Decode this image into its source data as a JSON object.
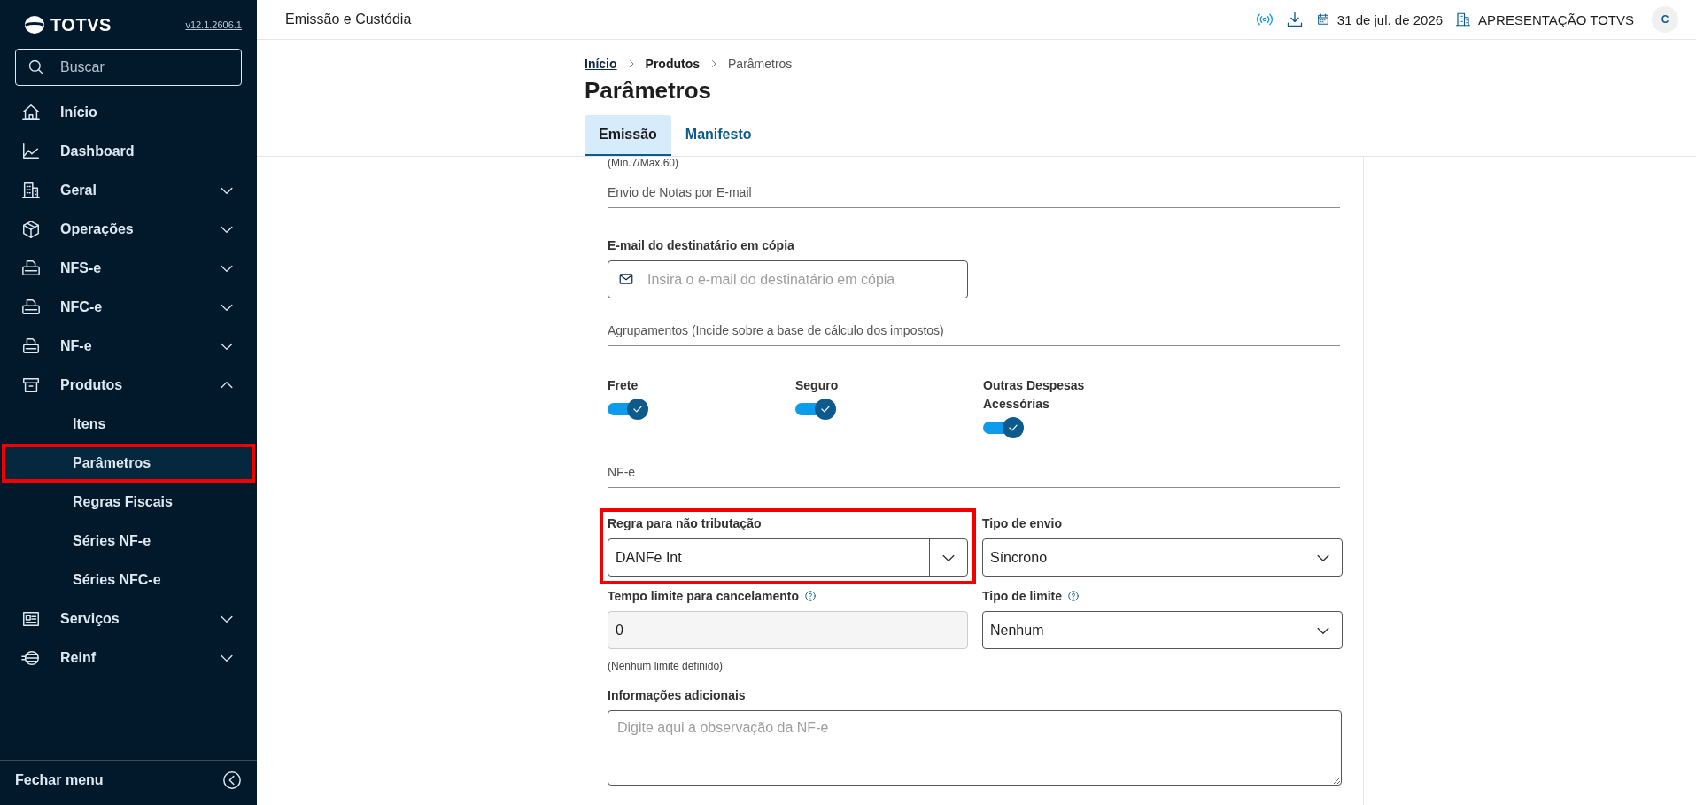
{
  "sidebar": {
    "logo": "TOTVS",
    "version": "v12.1.2606.1",
    "search": {
      "placeholder": "Buscar"
    },
    "items": [
      {
        "label": "Início",
        "kind": "link"
      },
      {
        "label": "Dashboard",
        "kind": "link"
      },
      {
        "label": "Geral",
        "kind": "group",
        "expanded": false
      },
      {
        "label": "Operações",
        "kind": "group",
        "expanded": false
      },
      {
        "label": "NFS-e",
        "kind": "group",
        "expanded": false
      },
      {
        "label": "NFC-e",
        "kind": "group",
        "expanded": false
      },
      {
        "label": "NF-e",
        "kind": "group",
        "expanded": false
      },
      {
        "label": "Produtos",
        "kind": "group",
        "expanded": true,
        "children": [
          {
            "label": "Itens",
            "selected": false,
            "highlighted": false
          },
          {
            "label": "Parâmetros",
            "selected": true,
            "highlighted": true
          },
          {
            "label": "Regras Fiscais",
            "selected": false,
            "highlighted": false
          },
          {
            "label": "Séries NF-e",
            "selected": false,
            "highlighted": false
          },
          {
            "label": "Séries NFC-e",
            "selected": false,
            "highlighted": false
          }
        ]
      },
      {
        "label": "Serviços",
        "kind": "group",
        "expanded": false
      },
      {
        "label": "Reinf",
        "kind": "group",
        "expanded": false
      }
    ],
    "footer": "Fechar menu"
  },
  "header": {
    "title": "Emissão e Custódia",
    "date": "31 de jul. de 2026",
    "company": "APRESENTAÇÃO TOTVS",
    "avatar": "C"
  },
  "page": {
    "breadcrumb": [
      {
        "label": "Início",
        "kind": "link"
      },
      {
        "label": "Produtos",
        "kind": "parent"
      },
      {
        "label": "Parâmetros",
        "kind": "current"
      }
    ],
    "title": "Parâmetros",
    "tabs": [
      {
        "label": "Emissão",
        "selected": true
      },
      {
        "label": "Manifesto",
        "selected": false
      }
    ]
  },
  "form": {
    "items": [
      {
        "kind": "note",
        "text": "(Min.7/Max.60)"
      },
      {
        "kind": "section",
        "title": "Envio de Notas por E-mail"
      },
      {
        "kind": "email",
        "label": "E-mail do destinatário em cópia",
        "placeholder": "Insira o e-mail do destinatário em cópia"
      },
      {
        "kind": "section",
        "title": "Agrupamentos (Incide sobre a base de cálculo dos impostos)"
      },
      {
        "kind": "switches",
        "items": [
          {
            "label": "Frete",
            "on": true
          },
          {
            "label": "Seguro",
            "on": true
          },
          {
            "label": "Outras Despesas Acessórias",
            "on": true
          }
        ]
      },
      {
        "kind": "section",
        "title": "NF-e"
      },
      {
        "kind": "grid",
        "fields": [
          {
            "kind": "combo",
            "label": "Regra para não tributação",
            "value": "DANFe Int",
            "help": false,
            "highlighted": true
          },
          {
            "kind": "select",
            "label": "Tipo de envio",
            "value": "Síncrono",
            "help": false,
            "highlighted": false
          },
          {
            "kind": "input",
            "label": "Tempo limite para cancelamento",
            "value": "0",
            "help": true,
            "disabled": true,
            "hint": "(Nenhum limite definido)",
            "highlighted": false
          },
          {
            "kind": "select",
            "label": "Tipo de limite",
            "value": "Nenhum",
            "help": true,
            "highlighted": false
          }
        ]
      },
      {
        "kind": "textarea",
        "label": "Informações adicionais",
        "placeholder": "Digite aqui a observação da NF-e"
      }
    ]
  }
}
